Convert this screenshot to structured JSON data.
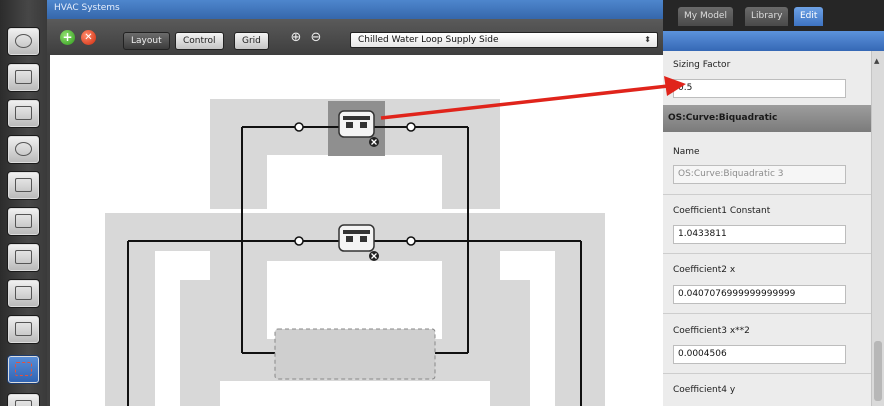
{
  "window": {
    "title": "HVAC Systems"
  },
  "toolbar": {
    "add_label": "+",
    "delete_label": "✕",
    "layout_label": "Layout",
    "control_label": "Control",
    "grid_label": "Grid",
    "zoom_in_label": "⊕",
    "zoom_out_label": "⊖",
    "loop_selected": "Chilled Water Loop Supply Side",
    "select_caret": "⬍"
  },
  "sidebar": {
    "items": [
      {
        "icon": "sphere-icon"
      },
      {
        "icon": "calendar-icon"
      },
      {
        "icon": "constructions-icon"
      },
      {
        "icon": "loads-icon"
      },
      {
        "icon": "space-types-icon"
      },
      {
        "icon": "building-icon"
      },
      {
        "icon": "thermal-zones-icon"
      },
      {
        "icon": "facility-icon"
      },
      {
        "icon": "spaces-icon"
      },
      {
        "icon": "hvac-systems-icon",
        "active": true
      },
      {
        "icon": "measures-icon"
      }
    ]
  },
  "inspector": {
    "tabs": [
      "My Model",
      "Library",
      "Edit"
    ],
    "active_tab": "Edit",
    "sizing_factor": {
      "label": "Sizing Factor",
      "value": "0.5"
    },
    "section_title": "OS:Curve:Biquadratic",
    "name_field": {
      "label": "Name",
      "value": "OS:Curve:Biquadratic 3"
    },
    "coefficient1": {
      "label": "Coefficient1 Constant",
      "value": "1.0433811"
    },
    "coefficient2": {
      "label": "Coefficient2 x",
      "value": "0.0407076999999999999"
    },
    "coefficient3": {
      "label": "Coefficient3 x**2",
      "value": "0.0004506"
    },
    "coefficient4": {
      "label": "Coefficient4 y"
    }
  },
  "colors": {
    "accent_blue": "#3d73c2",
    "callout_red": "#e0241b",
    "loop_shade": "#d8d8d8",
    "selected_component": "#8f8f8f"
  }
}
